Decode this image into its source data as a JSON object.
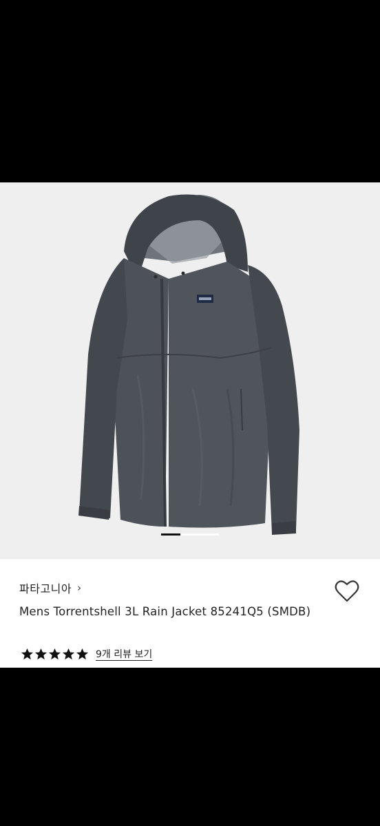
{
  "product": {
    "brand": "파타고니아",
    "brand_chevron": "›",
    "title": "Mens Torrentshell 3L Rain Jacket 85241Q5 (SMDB)",
    "rating_stars": 5,
    "review_link": "9개 리뷰 보기"
  },
  "gallery": {
    "image_subject": "dark grey hooded rain jacket",
    "page_count": 3,
    "active_page": 1
  },
  "colors": {
    "jacket": "#4a4f56",
    "background": "#efefef",
    "text": "#222222"
  },
  "icons": {
    "favorite": "heart-outline-icon",
    "star": "star-filled-icon"
  }
}
